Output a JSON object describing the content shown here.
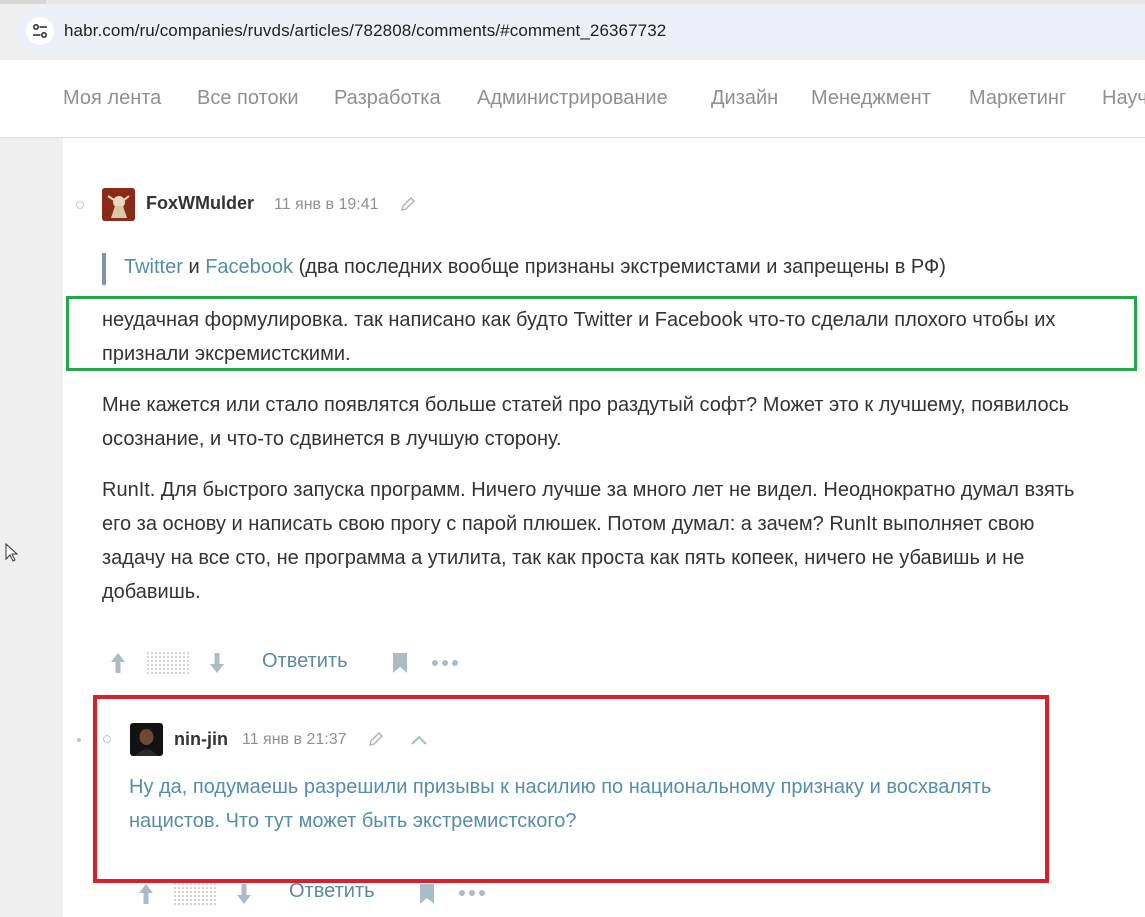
{
  "browser": {
    "url": "habr.com/ru/companies/ruvds/articles/782808/comments/#comment_26367732",
    "site_info_icon": "tune-icon"
  },
  "nav": {
    "items": [
      "Моя лента",
      "Все потоки",
      "Разработка",
      "Администрирование",
      "Дизайн",
      "Менеджмент",
      "Маркетинг",
      "Науч"
    ]
  },
  "comment": {
    "author": "FoxWMulder",
    "time": "11 янв в 19:41",
    "quote": {
      "link1": "Twitter",
      "and": " и ",
      "link2": "Facebook",
      "rest": " (два последних вообще признаны экстремистами и запрещены в РФ)"
    },
    "paragraphs": [
      "неудачная формулировка. так написано как будто Twitter и Facebook что-то сделали плохого чтобы их признали эксремистскими.",
      "Мне кажется или стало появлятся больше статей про раздутый софт? Может это к лучшему, появилось осознание, и что-то сдвинется в лучшую сторону.",
      "RunIt. Для быстрого запуска программ. Ничего лучше за много лет не видел. Неоднократно думал взять его за основу и написать свою прогу с парой плюшек. Потом думал: а зачем? RunIt выполняет свою задачу на все сто, не программа а утилита, так как проста как пять копеек, ничего не убавишь и не добавишь."
    ],
    "reply_label": "Ответить"
  },
  "reply": {
    "author": "nin-jin",
    "time": "11 янв в 21:37",
    "text": "Ну да, подумаешь разрешили призывы к насилию по национальному признаку и восхвалять нацистов. Что тут может быть экстремистского?",
    "reply_label": "Ответить"
  },
  "colors": {
    "link": "#548eaa",
    "highlight_green": "#22a84a",
    "highlight_red": "#d8202c"
  }
}
